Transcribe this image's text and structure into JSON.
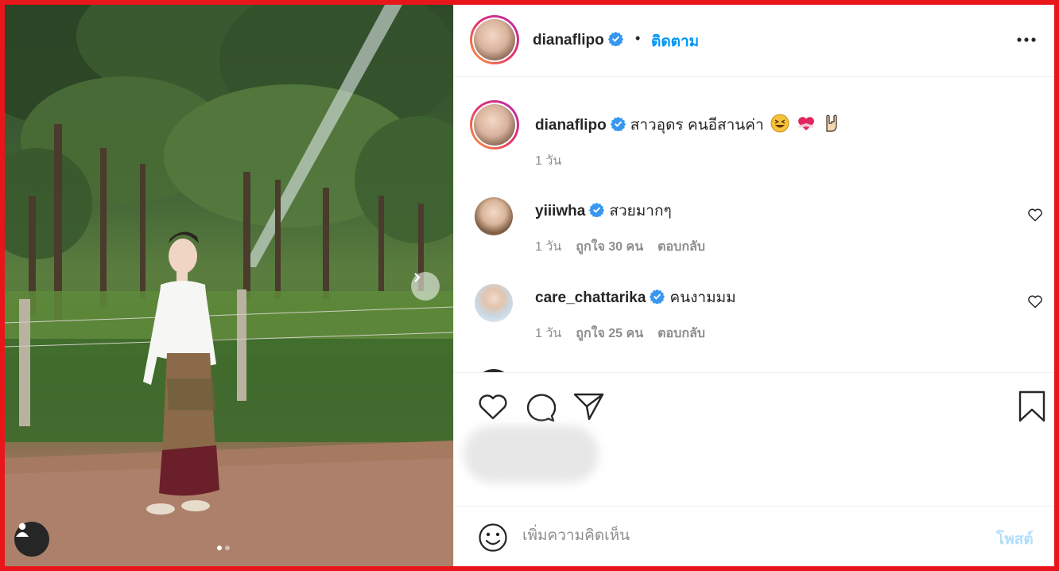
{
  "post": {
    "author": {
      "username": "dianaflipo",
      "verified": true
    },
    "follow_label": "ติดตาม",
    "separator": "•",
    "caption": {
      "text": "สาวอุดร คนอีสานค่า",
      "emoji": [
        "grinning-squinting-face",
        "heart-with-ribbon",
        "sign-of-the-horns"
      ],
      "time": "1 วัน"
    },
    "carousel": {
      "slide_count": 2,
      "current_slide": 1
    }
  },
  "comments": [
    {
      "username": "yiiiwha",
      "verified": true,
      "text": "สวยมากๆ",
      "time": "1 วัน",
      "likes_label": "ถูกใจ 30 คน",
      "reply_label": "ตอบกลับ",
      "avatar_color": "#e8cdb3"
    },
    {
      "username": "care_chattarika",
      "verified": true,
      "text": "คนงามมม",
      "time": "1 วัน",
      "likes_label": "ถูกใจ 25 คน",
      "reply_label": "ตอบกลับ",
      "avatar_color": "#e9ecef"
    }
  ],
  "add_comment": {
    "placeholder": "เพิ่มความคิดเห็น",
    "post_label": "โพสต์"
  },
  "colors": {
    "accent": "#0095f6",
    "post_disabled": "#b2dffc",
    "frame": "#e8161b",
    "verified": "#3897f0"
  },
  "icons": [
    "more-icon",
    "verified-icon",
    "heart-icon",
    "comment-icon",
    "share-icon",
    "bookmark-icon",
    "emoji-icon",
    "user-tag-icon",
    "chevron-right-icon"
  ]
}
